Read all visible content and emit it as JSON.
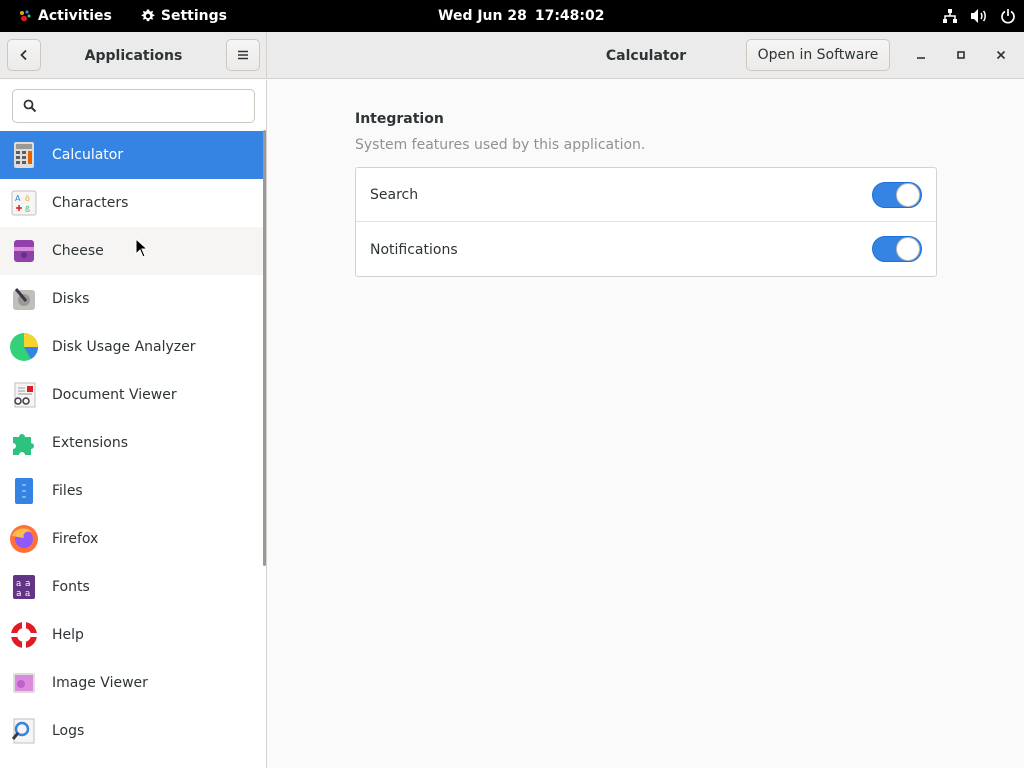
{
  "topbar": {
    "activities": "Activities",
    "app_menu": "Settings",
    "date": "Wed Jun 28",
    "time": "17:48:02",
    "tray_icons": [
      "network-icon",
      "volume-icon",
      "power-icon"
    ]
  },
  "window": {
    "sidebar_title": "Applications",
    "content_title": "Calculator",
    "open_in_software": "Open in Software"
  },
  "search": {
    "placeholder": "",
    "value": ""
  },
  "apps": [
    {
      "label": "Calculator",
      "icon": "calculator-icon",
      "selected": true
    },
    {
      "label": "Characters",
      "icon": "characters-icon"
    },
    {
      "label": "Cheese",
      "icon": "cheese-icon",
      "hover": true
    },
    {
      "label": "Disks",
      "icon": "disks-icon"
    },
    {
      "label": "Disk Usage Analyzer",
      "icon": "disk-usage-analyzer-icon"
    },
    {
      "label": "Document Viewer",
      "icon": "document-viewer-icon"
    },
    {
      "label": "Extensions",
      "icon": "extensions-icon"
    },
    {
      "label": "Files",
      "icon": "files-icon"
    },
    {
      "label": "Firefox",
      "icon": "firefox-icon"
    },
    {
      "label": "Fonts",
      "icon": "fonts-icon"
    },
    {
      "label": "Help",
      "icon": "help-icon"
    },
    {
      "label": "Image Viewer",
      "icon": "image-viewer-icon"
    },
    {
      "label": "Logs",
      "icon": "logs-icon"
    }
  ],
  "integration": {
    "title": "Integration",
    "subtitle": "System features used by this application.",
    "rows": [
      {
        "label": "Search",
        "enabled": true
      },
      {
        "label": "Notifications",
        "enabled": true
      }
    ]
  },
  "colors": {
    "accent": "#3584e4",
    "topbar": "#000000",
    "headerbar": "#ebebeb"
  }
}
